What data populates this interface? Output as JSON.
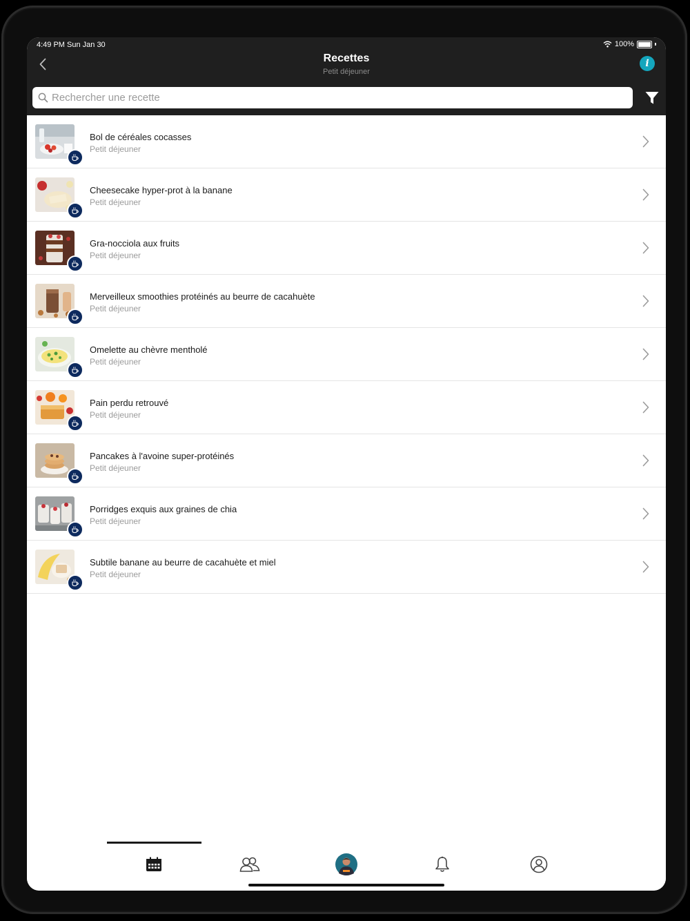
{
  "status_bar": {
    "time": "4:49 PM  Sun Jan 30",
    "battery": "100%"
  },
  "header": {
    "title": "Recettes",
    "subtitle": "Petit déjeuner"
  },
  "search": {
    "placeholder": "Rechercher une recette"
  },
  "recipes": [
    {
      "title": "Bol de céréales cocasses",
      "category": "Petit déjeuner"
    },
    {
      "title": "Cheesecake hyper-prot à la banane",
      "category": "Petit déjeuner"
    },
    {
      "title": "Gra-nocciola aux fruits",
      "category": "Petit déjeuner"
    },
    {
      "title": "Merveilleux smoothies protéinés au beurre de cacahuète",
      "category": "Petit déjeuner"
    },
    {
      "title": "Omelette au chèvre mentholé",
      "category": "Petit déjeuner"
    },
    {
      "title": "Pain perdu retrouvé",
      "category": "Petit déjeuner"
    },
    {
      "title": "Pancakes à l'avoine super-protéinés",
      "category": "Petit déjeuner"
    },
    {
      "title": "Porridges exquis aux graines de chia",
      "category": "Petit déjeuner"
    },
    {
      "title": "Subtile banane au beurre de cacahuète et miel",
      "category": "Petit déjeuner"
    }
  ],
  "tab_bar": {
    "tabs": [
      {
        "icon": "calendar-icon",
        "active": true
      },
      {
        "icon": "community-icon",
        "active": false
      },
      {
        "icon": "coach-avatar-icon",
        "active": false
      },
      {
        "icon": "bell-icon",
        "active": false
      },
      {
        "icon": "profile-icon",
        "active": false
      }
    ]
  },
  "colors": {
    "header_bg": "#1f1f1f",
    "accent_info": "#14a6bd",
    "badge": "#0d2a5e"
  }
}
